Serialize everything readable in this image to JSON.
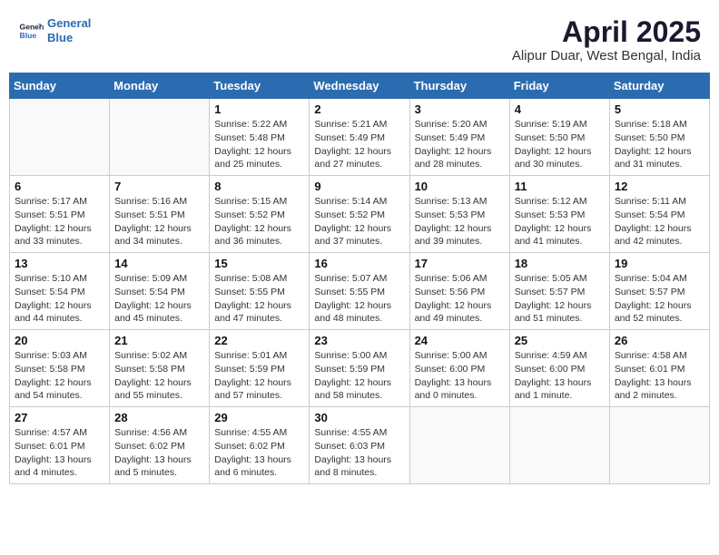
{
  "logo": {
    "line1": "General",
    "line2": "Blue"
  },
  "title": "April 2025",
  "subtitle": "Alipur Duar, West Bengal, India",
  "weekdays": [
    "Sunday",
    "Monday",
    "Tuesday",
    "Wednesday",
    "Thursday",
    "Friday",
    "Saturday"
  ],
  "weeks": [
    [
      {
        "day": "",
        "info": ""
      },
      {
        "day": "",
        "info": ""
      },
      {
        "day": "1",
        "info": "Sunrise: 5:22 AM\nSunset: 5:48 PM\nDaylight: 12 hours\nand 25 minutes."
      },
      {
        "day": "2",
        "info": "Sunrise: 5:21 AM\nSunset: 5:49 PM\nDaylight: 12 hours\nand 27 minutes."
      },
      {
        "day": "3",
        "info": "Sunrise: 5:20 AM\nSunset: 5:49 PM\nDaylight: 12 hours\nand 28 minutes."
      },
      {
        "day": "4",
        "info": "Sunrise: 5:19 AM\nSunset: 5:50 PM\nDaylight: 12 hours\nand 30 minutes."
      },
      {
        "day": "5",
        "info": "Sunrise: 5:18 AM\nSunset: 5:50 PM\nDaylight: 12 hours\nand 31 minutes."
      }
    ],
    [
      {
        "day": "6",
        "info": "Sunrise: 5:17 AM\nSunset: 5:51 PM\nDaylight: 12 hours\nand 33 minutes."
      },
      {
        "day": "7",
        "info": "Sunrise: 5:16 AM\nSunset: 5:51 PM\nDaylight: 12 hours\nand 34 minutes."
      },
      {
        "day": "8",
        "info": "Sunrise: 5:15 AM\nSunset: 5:52 PM\nDaylight: 12 hours\nand 36 minutes."
      },
      {
        "day": "9",
        "info": "Sunrise: 5:14 AM\nSunset: 5:52 PM\nDaylight: 12 hours\nand 37 minutes."
      },
      {
        "day": "10",
        "info": "Sunrise: 5:13 AM\nSunset: 5:53 PM\nDaylight: 12 hours\nand 39 minutes."
      },
      {
        "day": "11",
        "info": "Sunrise: 5:12 AM\nSunset: 5:53 PM\nDaylight: 12 hours\nand 41 minutes."
      },
      {
        "day": "12",
        "info": "Sunrise: 5:11 AM\nSunset: 5:54 PM\nDaylight: 12 hours\nand 42 minutes."
      }
    ],
    [
      {
        "day": "13",
        "info": "Sunrise: 5:10 AM\nSunset: 5:54 PM\nDaylight: 12 hours\nand 44 minutes."
      },
      {
        "day": "14",
        "info": "Sunrise: 5:09 AM\nSunset: 5:54 PM\nDaylight: 12 hours\nand 45 minutes."
      },
      {
        "day": "15",
        "info": "Sunrise: 5:08 AM\nSunset: 5:55 PM\nDaylight: 12 hours\nand 47 minutes."
      },
      {
        "day": "16",
        "info": "Sunrise: 5:07 AM\nSunset: 5:55 PM\nDaylight: 12 hours\nand 48 minutes."
      },
      {
        "day": "17",
        "info": "Sunrise: 5:06 AM\nSunset: 5:56 PM\nDaylight: 12 hours\nand 49 minutes."
      },
      {
        "day": "18",
        "info": "Sunrise: 5:05 AM\nSunset: 5:57 PM\nDaylight: 12 hours\nand 51 minutes."
      },
      {
        "day": "19",
        "info": "Sunrise: 5:04 AM\nSunset: 5:57 PM\nDaylight: 12 hours\nand 52 minutes."
      }
    ],
    [
      {
        "day": "20",
        "info": "Sunrise: 5:03 AM\nSunset: 5:58 PM\nDaylight: 12 hours\nand 54 minutes."
      },
      {
        "day": "21",
        "info": "Sunrise: 5:02 AM\nSunset: 5:58 PM\nDaylight: 12 hours\nand 55 minutes."
      },
      {
        "day": "22",
        "info": "Sunrise: 5:01 AM\nSunset: 5:59 PM\nDaylight: 12 hours\nand 57 minutes."
      },
      {
        "day": "23",
        "info": "Sunrise: 5:00 AM\nSunset: 5:59 PM\nDaylight: 12 hours\nand 58 minutes."
      },
      {
        "day": "24",
        "info": "Sunrise: 5:00 AM\nSunset: 6:00 PM\nDaylight: 13 hours\nand 0 minutes."
      },
      {
        "day": "25",
        "info": "Sunrise: 4:59 AM\nSunset: 6:00 PM\nDaylight: 13 hours\nand 1 minute."
      },
      {
        "day": "26",
        "info": "Sunrise: 4:58 AM\nSunset: 6:01 PM\nDaylight: 13 hours\nand 2 minutes."
      }
    ],
    [
      {
        "day": "27",
        "info": "Sunrise: 4:57 AM\nSunset: 6:01 PM\nDaylight: 13 hours\nand 4 minutes."
      },
      {
        "day": "28",
        "info": "Sunrise: 4:56 AM\nSunset: 6:02 PM\nDaylight: 13 hours\nand 5 minutes."
      },
      {
        "day": "29",
        "info": "Sunrise: 4:55 AM\nSunset: 6:02 PM\nDaylight: 13 hours\nand 6 minutes."
      },
      {
        "day": "30",
        "info": "Sunrise: 4:55 AM\nSunset: 6:03 PM\nDaylight: 13 hours\nand 8 minutes."
      },
      {
        "day": "",
        "info": ""
      },
      {
        "day": "",
        "info": ""
      },
      {
        "day": "",
        "info": ""
      }
    ]
  ]
}
